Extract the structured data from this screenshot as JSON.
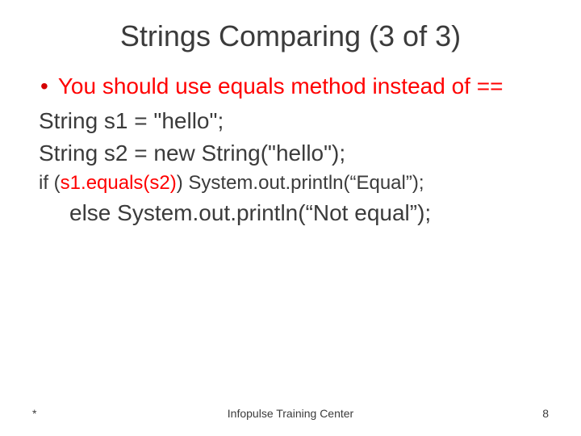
{
  "title": "Strings Comparing (3 of 3)",
  "bullet": {
    "text": "You should use equals method instead of =="
  },
  "code": {
    "line1": "String s1 = \"hello\";",
    "line2": "String s2 = new String(\"hello\");",
    "line3_prefix": "if (",
    "line3_highlight": "s1.equals(s2)",
    "line3_suffix": ") System.out.println(“Equal”);",
    "line4": "else System.out.println(“Not equal”);"
  },
  "footer": {
    "left": "*",
    "center": "Infopulse Training Center",
    "right": "8"
  }
}
